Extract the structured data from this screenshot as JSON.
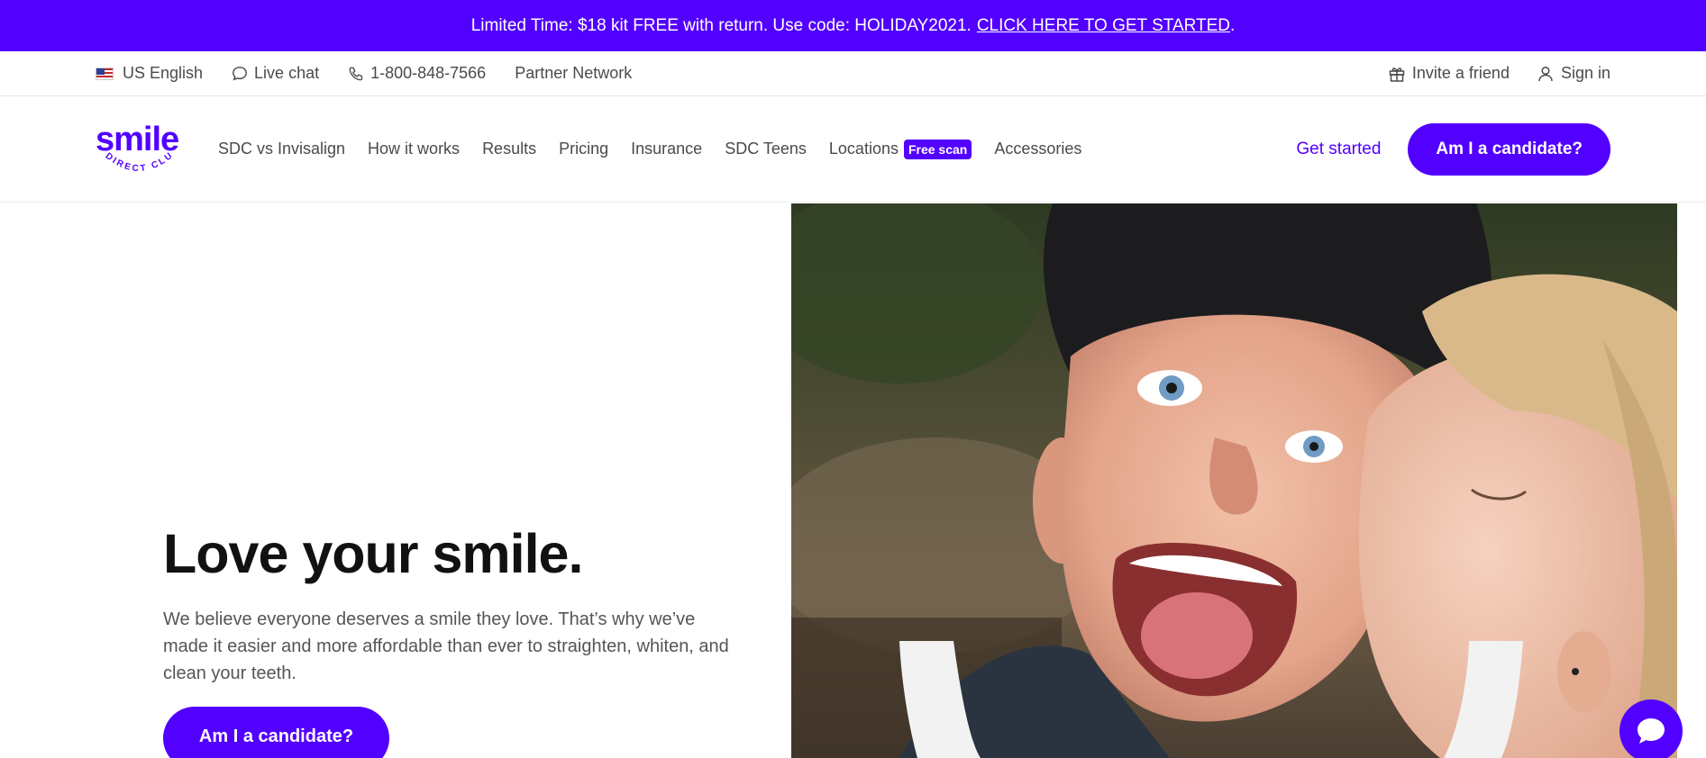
{
  "promo": {
    "text": "Limited Time: $18 kit FREE with return. Use code: HOLIDAY2021.",
    "link": "CLICK HERE TO GET STARTED",
    "trail": "."
  },
  "utility": {
    "language": "US English",
    "live_chat": "Live chat",
    "phone": "1-800-848-7566",
    "partner": "Partner Network",
    "invite": "Invite a friend",
    "signin": "Sign in"
  },
  "logo": {
    "word": "smile",
    "tagline": "DIRECT CLUB"
  },
  "nav": {
    "links": [
      "SDC vs Invisalign",
      "How it works",
      "Results",
      "Pricing",
      "Insurance",
      "SDC Teens",
      "Locations",
      "Accessories"
    ],
    "locations_badge": "Free scan",
    "get_started": "Get started",
    "cta": "Am I a candidate?"
  },
  "hero": {
    "title": "Love your smile.",
    "body": "We believe everyone deserves a smile they love. That’s why we’ve made it easier and more affordable than ever to straighten, whiten, and clean your teeth.",
    "cta": "Am I a candidate?"
  },
  "colors": {
    "brand": "#5200ff",
    "heading": "#111111",
    "text": "#4a4a4a"
  },
  "icons": [
    "us-flag-icon",
    "chat-bubble-icon",
    "phone-icon",
    "gift-icon",
    "user-icon",
    "chat-widget-icon"
  ]
}
